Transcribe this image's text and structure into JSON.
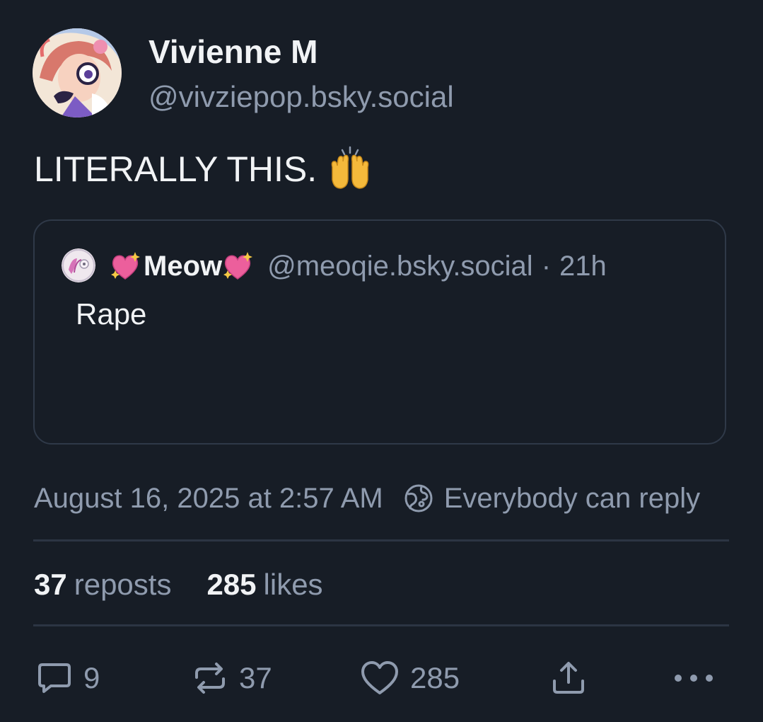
{
  "author": {
    "display_name": "Vivienne M",
    "handle": "@vivziepop.bsky.social",
    "avatar_icon": "avatar"
  },
  "post": {
    "text": "LITERALLY THIS.",
    "emoji": "raising-hands-emoji"
  },
  "quote": {
    "display_name": "Meow",
    "name_emoji": "sparkling-heart-emoji",
    "handle": "@meoqie.bsky.social",
    "separator": "·",
    "time": "21h",
    "text": "Rape"
  },
  "meta": {
    "timestamp": "August 16, 2025 at 2:57 AM",
    "reply_setting": "Everybody can reply",
    "reply_icon": "globe-icon"
  },
  "stats": {
    "reposts_count": "37",
    "reposts_label": "reposts",
    "likes_count": "285",
    "likes_label": "likes"
  },
  "actions": {
    "reply_count": "9",
    "repost_count": "37",
    "like_count": "285"
  },
  "colors": {
    "background": "#171d26",
    "primary_text": "#f1f3f5",
    "secondary_text": "#8f9bae",
    "border": "#2f3948",
    "emoji_yellow": "#f4b93b",
    "emoji_pink": "#ec5f9c"
  }
}
